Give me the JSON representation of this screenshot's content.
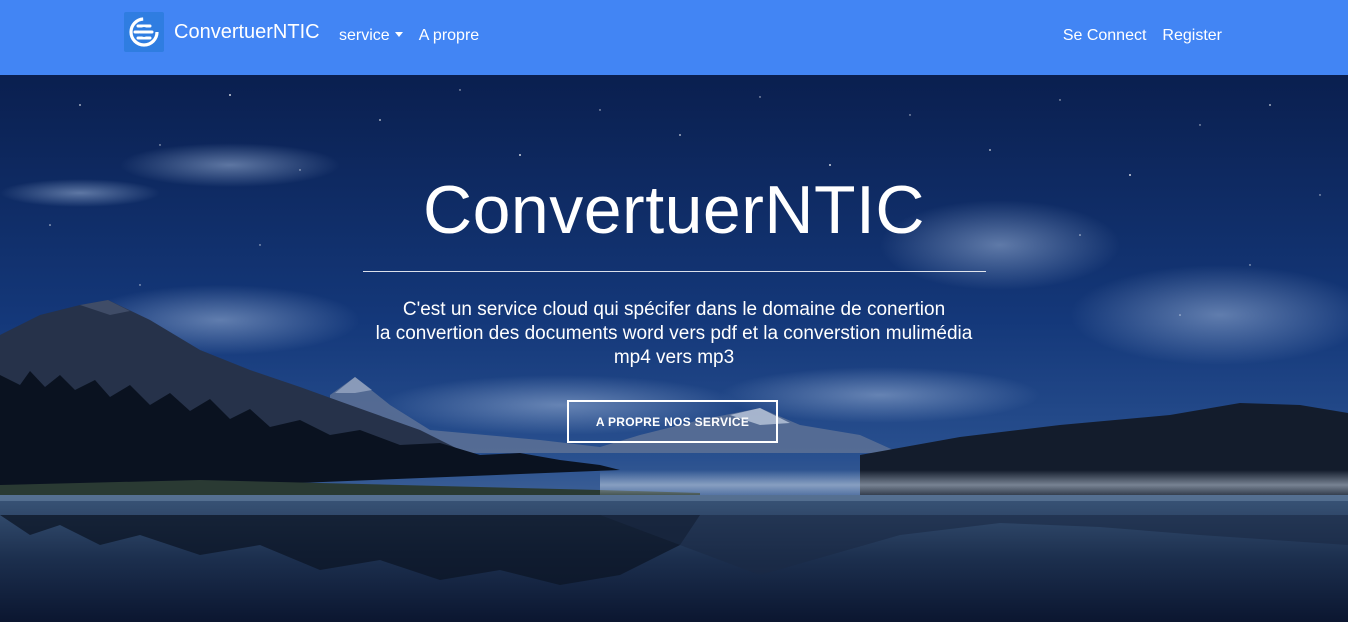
{
  "navbar": {
    "brand_name": "ConvertuerNTIC",
    "logo_icon": "refresh-e-logo-icon",
    "left_links": [
      {
        "label": "service",
        "has_dropdown": true
      },
      {
        "label": "A propre"
      }
    ],
    "right_links": [
      {
        "label": "Se Connect"
      },
      {
        "label": "Register"
      }
    ],
    "background_color": "#4285f4"
  },
  "hero": {
    "title": "ConvertuerNTIC",
    "description_lines": [
      "C'est un service cloud qui spécifer dans le domaine de conertion",
      "la convertion des documents word vers pdf et la converstion mulimédia",
      "mp4 vers mp3"
    ],
    "button_label": "A PROPRE NOS SERVICE"
  }
}
